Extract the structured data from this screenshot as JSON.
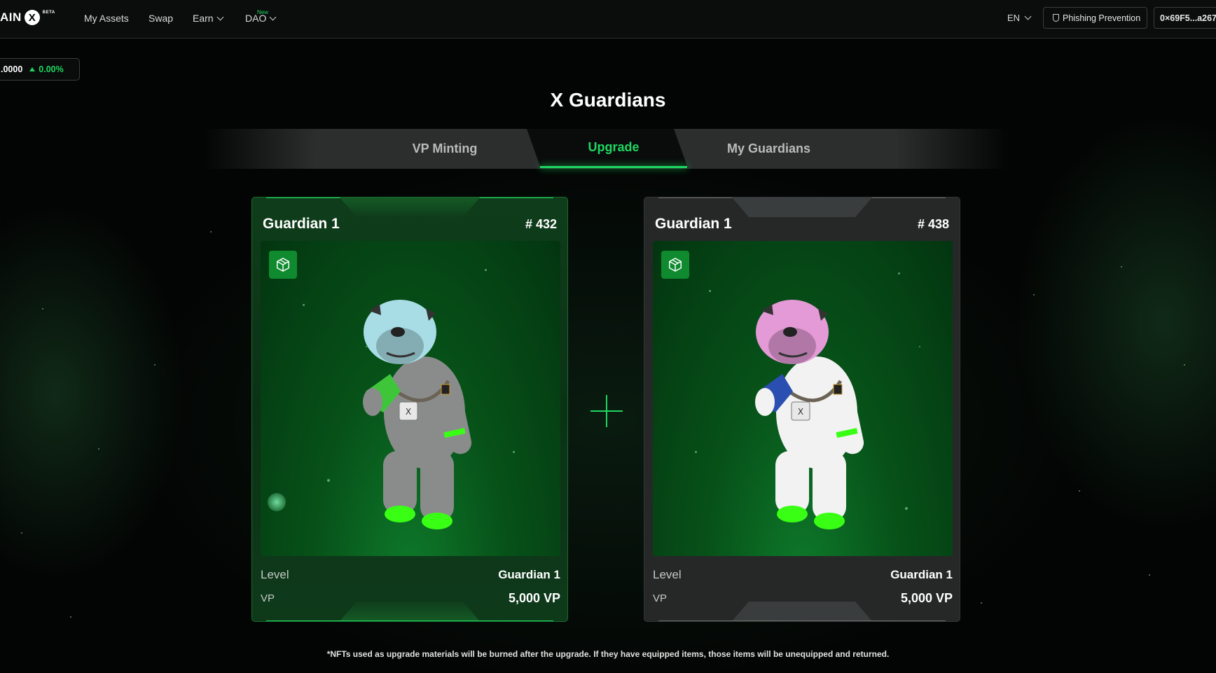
{
  "nav": {
    "logo_text": "AIN",
    "logo_badge": "BETA",
    "items": [
      {
        "label": "My Assets"
      },
      {
        "label": "Swap"
      },
      {
        "label": "Earn"
      },
      {
        "label": "DAO",
        "badge": "New"
      }
    ],
    "language": "EN",
    "phishing_label": "Phishing Prevention",
    "wallet_address": "0×69F5...a267"
  },
  "ticker": {
    "price": ".0000",
    "change": "0.00%"
  },
  "page": {
    "title": "X Guardians"
  },
  "tabs": [
    {
      "label": "VP Minting"
    },
    {
      "label": "Upgrade",
      "active": true
    },
    {
      "label": "My Guardians"
    }
  ],
  "cards": [
    {
      "name": "Guardian 1",
      "id": "# 432",
      "level_label": "Level",
      "level_value": "Guardian 1",
      "vp_label": "VP",
      "vp_value": "5,000 VP",
      "helmet_color": "#a8dde6",
      "suit_color": "#8a8c8c",
      "gun_color": "#3ec53a"
    },
    {
      "name": "Guardian 1",
      "id": "# 438",
      "level_label": "Level",
      "level_value": "Guardian 1",
      "vp_label": "VP",
      "vp_value": "5,000 VP",
      "helmet_color": "#e39ad6",
      "suit_color": "#f2f2f2",
      "gun_color": "#2a4fb0"
    }
  ],
  "footnote": "*NFTs used as upgrade materials will be burned after the upgrade. If they have equipped items, those items will be unequipped and returned.",
  "colors": {
    "accent": "#1ed760",
    "background": "#030504"
  }
}
